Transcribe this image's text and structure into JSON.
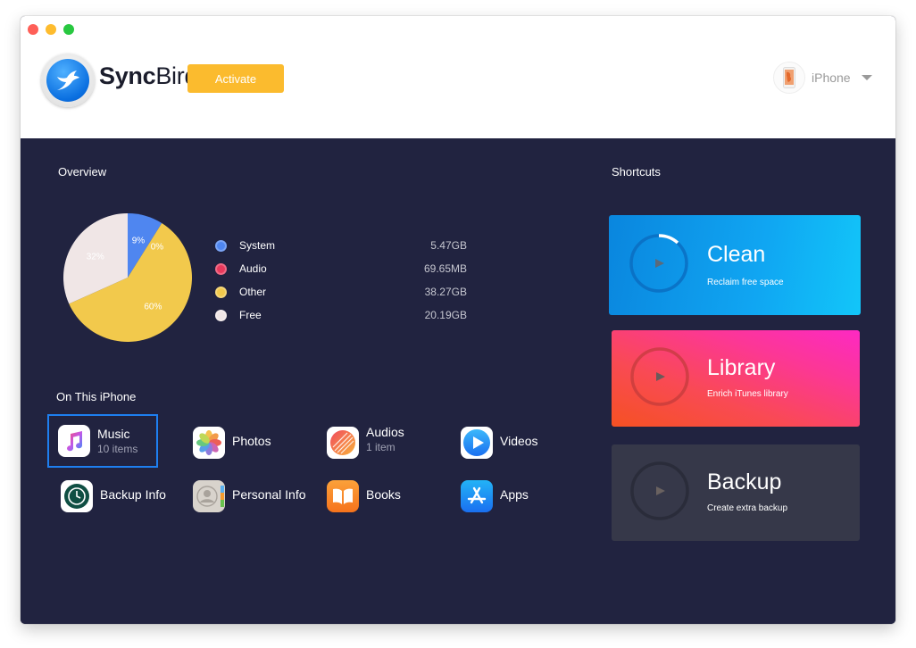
{
  "window": {
    "app_name_bold": "Sync",
    "app_name_light": "Bird",
    "activate_label": "Activate",
    "device": {
      "name": "iPhone"
    }
  },
  "overview": {
    "title": "Overview",
    "legend": [
      {
        "name": "System",
        "value": "5.47GB",
        "color": "#4f86f0"
      },
      {
        "name": "Audio",
        "value": "69.65MB",
        "color": "#e8395c"
      },
      {
        "name": "Other",
        "value": "38.27GB",
        "color": "#f2c94c"
      },
      {
        "name": "Free",
        "value": "20.19GB",
        "color": "#f0e6e6"
      }
    ],
    "chart_data": {
      "type": "pie",
      "title": "Overview",
      "categories": [
        "System",
        "Audio",
        "Other",
        "Free"
      ],
      "values": [
        9,
        0,
        60,
        32
      ],
      "labels": [
        "9%",
        "0%",
        "60%",
        "32%"
      ],
      "colors": [
        "#4f86f0",
        "#e8395c",
        "#f2c94c",
        "#f0e6e6"
      ],
      "legend": "right"
    }
  },
  "on_this_iphone": {
    "title": "On This iPhone",
    "items": [
      {
        "label": "Music",
        "sub": "10 items",
        "icon": "music-icon",
        "selected": true
      },
      {
        "label": "Photos",
        "sub": "",
        "icon": "photos-icon"
      },
      {
        "label": "Audios",
        "sub": "1 item",
        "icon": "audios-icon"
      },
      {
        "label": "Videos",
        "sub": "",
        "icon": "videos-icon"
      },
      {
        "label": "Backup Info",
        "sub": "",
        "icon": "backup-info-icon"
      },
      {
        "label": "Personal Info",
        "sub": "",
        "icon": "personal-info-icon"
      },
      {
        "label": "Books",
        "sub": "",
        "icon": "books-icon"
      },
      {
        "label": "Apps",
        "sub": "",
        "icon": "apps-icon"
      }
    ]
  },
  "shortcuts": {
    "title": "Shortcuts",
    "items": [
      {
        "title": "Clean",
        "sub": "Reclaim free space",
        "icon": "play-icon"
      },
      {
        "title": "Library",
        "sub": "Enrich iTunes library",
        "icon": "play-icon"
      },
      {
        "title": "Backup",
        "sub": "Create extra backup",
        "icon": "play-icon"
      }
    ]
  }
}
